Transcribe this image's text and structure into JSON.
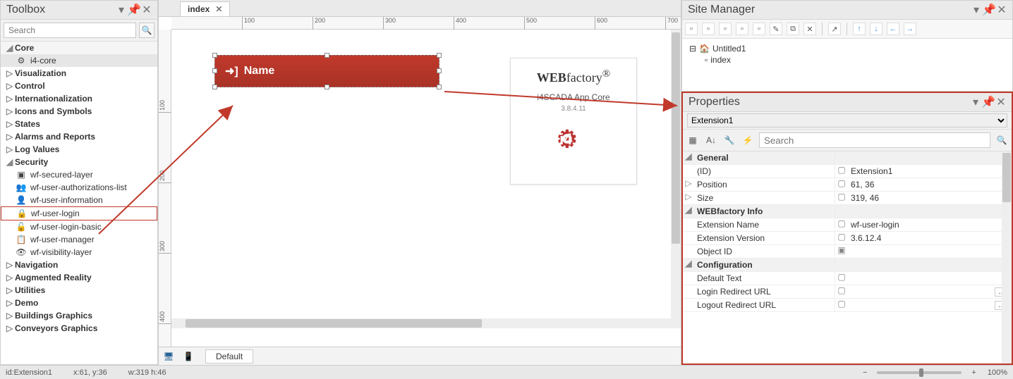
{
  "toolbox": {
    "title": "Toolbox",
    "search_placeholder": "Search",
    "groups": {
      "core_header": "Core",
      "core_item": "i4-core",
      "visualization": "Visualization",
      "control": "Control",
      "intl": "Internationalization",
      "icons": "Icons and Symbols",
      "states": "States",
      "alarms": "Alarms and Reports",
      "log": "Log Values",
      "security": "Security",
      "navigation": "Navigation",
      "ar": "Augmented Reality",
      "utilities": "Utilities",
      "demo": "Demo",
      "buildings": "Buildings Graphics",
      "conveyors": "Conveyors Graphics"
    },
    "security_items": {
      "secured_layer": "wf-secured-layer",
      "user_auth": "wf-user-authorizations-list",
      "user_info": "wf-user-information",
      "user_login": "wf-user-login",
      "user_login_basic": "wf-user-login-basic",
      "user_manager": "wf-user-manager",
      "visibility_layer": "wf-visibility-layer"
    }
  },
  "editor": {
    "tab": "index",
    "widget_label": "Name",
    "card_brand": "WEBfactory",
    "card_sub": "i4SCADA App Core",
    "card_ver": "3.8.4.11",
    "layer_default": "Default"
  },
  "ruler_h": [
    "100",
    "200",
    "300",
    "400",
    "500",
    "600",
    "700"
  ],
  "ruler_v": [
    "100",
    "200",
    "300",
    "400"
  ],
  "site": {
    "title": "Site Manager",
    "root": "Untitled1",
    "child": "index"
  },
  "props": {
    "title": "Properties",
    "object": "Extension1",
    "search_placeholder": "Search",
    "groups": {
      "general": "General",
      "wfinfo": "WEBfactory Info",
      "config": "Configuration"
    },
    "rows": {
      "id_k": "(ID)",
      "id_v": "Extension1",
      "pos_k": "Position",
      "pos_v": "61, 36",
      "size_k": "Size",
      "size_v": "319, 46",
      "extname_k": "Extension Name",
      "extname_v": "wf-user-login",
      "extver_k": "Extension Version",
      "extver_v": "3.6.12.4",
      "objid_k": "Object ID",
      "objid_v": "",
      "deftext_k": "Default Text",
      "deftext_v": "",
      "login_k": "Login Redirect URL",
      "login_v": "",
      "logout_k": "Logout Redirect URL",
      "logout_v": ""
    }
  },
  "status": {
    "id": "id:Extension1",
    "xy": "x:61, y:36",
    "wh": "w:319 h:46",
    "zoom": "100%"
  }
}
